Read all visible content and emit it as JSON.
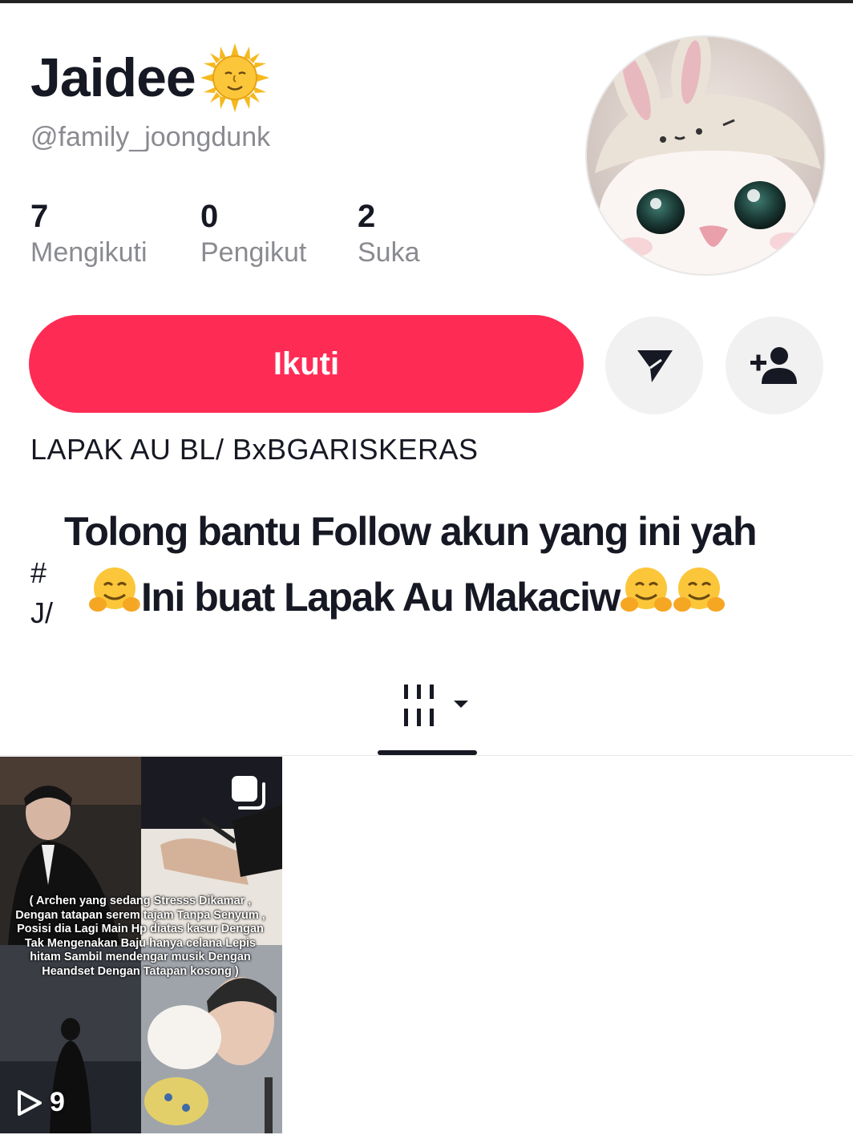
{
  "profile": {
    "display_name": "Jaidee",
    "handle": "@family_joongdunk",
    "name_emoji": "sun-with-face-emoji"
  },
  "stats": [
    {
      "value": "7",
      "label": "Mengikuti"
    },
    {
      "value": "0",
      "label": "Pengikut"
    },
    {
      "value": "2",
      "label": "Suka"
    }
  ],
  "actions": {
    "follow_label": "Ikuti",
    "message_icon": "send-icon",
    "suggest_icon": "add-person-icon"
  },
  "bio": {
    "line1": "LAPAK AU BL/ BxBGARISKERAS",
    "partial_line3": "#",
    "partial_line4": "J/"
  },
  "overlay": {
    "line1": "Tolong bantu Follow akun yang ini yah",
    "line2": "Ini buat Lapak Au Makaciw"
  },
  "tabs": {
    "active": "videos-grid-icon"
  },
  "videos": [
    {
      "caption": "( Archen yang sedang Stresss Dikamar , Dengan tatapan serem tajam Tanpa Senyum , Posisi dia Lagi Main Hp diatas kasur Dengan Tak Mengenakan Baju hanya celana Lepis hitam Sambil mendengar musik Dengan Heandset Dengan Tatapan kosong )",
      "play_count": "9"
    }
  ],
  "colors": {
    "accent": "#fe2c55",
    "text": "#161823",
    "secondary": "#8a8b91",
    "icon_bg": "#f1f1f2"
  }
}
